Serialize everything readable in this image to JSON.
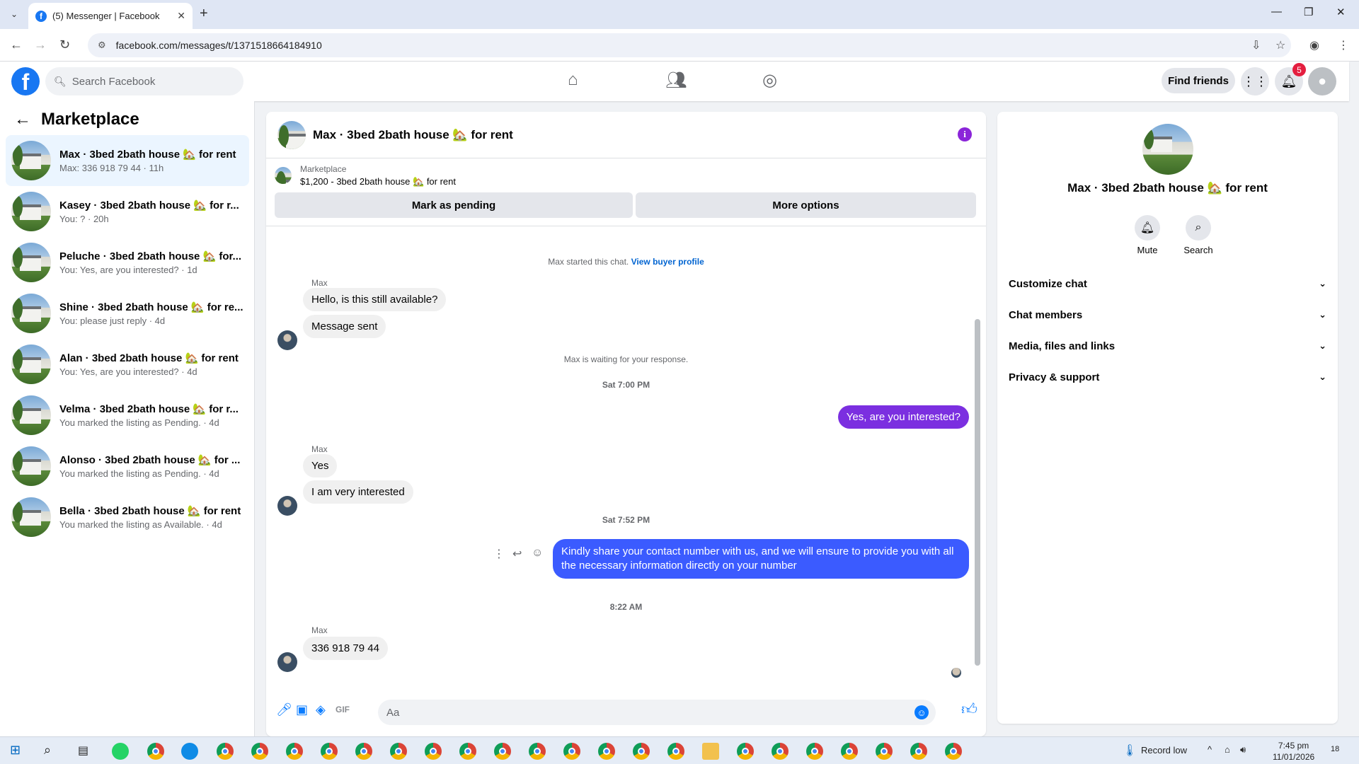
{
  "browser": {
    "tab_title": "(5) Messenger | Facebook",
    "url": "facebook.com/messages/t/1371518664184910"
  },
  "header": {
    "search_placeholder": "Search Facebook",
    "find_friends": "Find friends",
    "notification_count": "5",
    "nav_icons": [
      "home-icon",
      "friends-icon",
      "groups-icon"
    ]
  },
  "sidebar": {
    "title": "Marketplace",
    "conversations": [
      {
        "name": "Max · 3bed 2bath house 🏡 for rent",
        "preview": "Max: 336 918 79 44 · 11h",
        "active": true
      },
      {
        "name": "Kasey · 3bed 2bath house 🏡 for r...",
        "preview": "You: ? · 20h"
      },
      {
        "name": "Peluche · 3bed 2bath house 🏡 for...",
        "preview": "You: Yes, are you interested? · 1d"
      },
      {
        "name": "Shine · 3bed 2bath house 🏡 for re...",
        "preview": "You: please just reply · 4d"
      },
      {
        "name": "Alan · 3bed 2bath house 🏡 for rent",
        "preview": "You: Yes, are you interested? · 4d"
      },
      {
        "name": "Velma · 3bed 2bath house 🏡 for r...",
        "preview": "You marked the listing as Pending. · 4d"
      },
      {
        "name": "Alonso · 3bed 2bath house 🏡 for ...",
        "preview": "You marked the listing as Pending. · 4d"
      },
      {
        "name": "Bella · 3bed 2bath house 🏡 for rent",
        "preview": "You marked the listing as Available. · 4d"
      }
    ]
  },
  "chat": {
    "title": "Max · 3bed 2bath house 🏡 for rent",
    "marketplace_label": "Marketplace",
    "listing": "$1,200 - 3bed 2bath house 🏡 for rent",
    "mark_pending": "Mark as pending",
    "more_options": "More options",
    "started": "Max started this chat.",
    "view_buyer_profile": "View buyer profile",
    "sender_name": "Max",
    "msg1": "Hello, is this still available?",
    "msg2": "Message sent",
    "waiting": "Max is waiting for your response.",
    "time1": "Sat 7:00 PM",
    "out1": "Yes, are you interested?",
    "msg3": "Yes",
    "msg4": "I am very interested",
    "time2": "Sat 7:52 PM",
    "out2": "Kindly share your contact number with us, and we will ensure to provide you with all the necessary information directly on your number",
    "time3": "8:22 AM",
    "msg5": "336 918 79 44",
    "composer_placeholder": "Aa",
    "accent_in": "#f0f0f0",
    "accent_out_1": "#7b2fe0",
    "accent_out_2": "#3b5bff"
  },
  "details": {
    "title": "Max · 3bed 2bath house 🏡 for rent",
    "mute": "Mute",
    "search": "Search",
    "sections": [
      "Customize chat",
      "Chat members",
      "Media, files and links",
      "Privacy & support"
    ]
  },
  "taskbar": {
    "record_label": "Record low",
    "time": "7:45 pm",
    "date": "11/01/2026",
    "notif_count": "18"
  }
}
